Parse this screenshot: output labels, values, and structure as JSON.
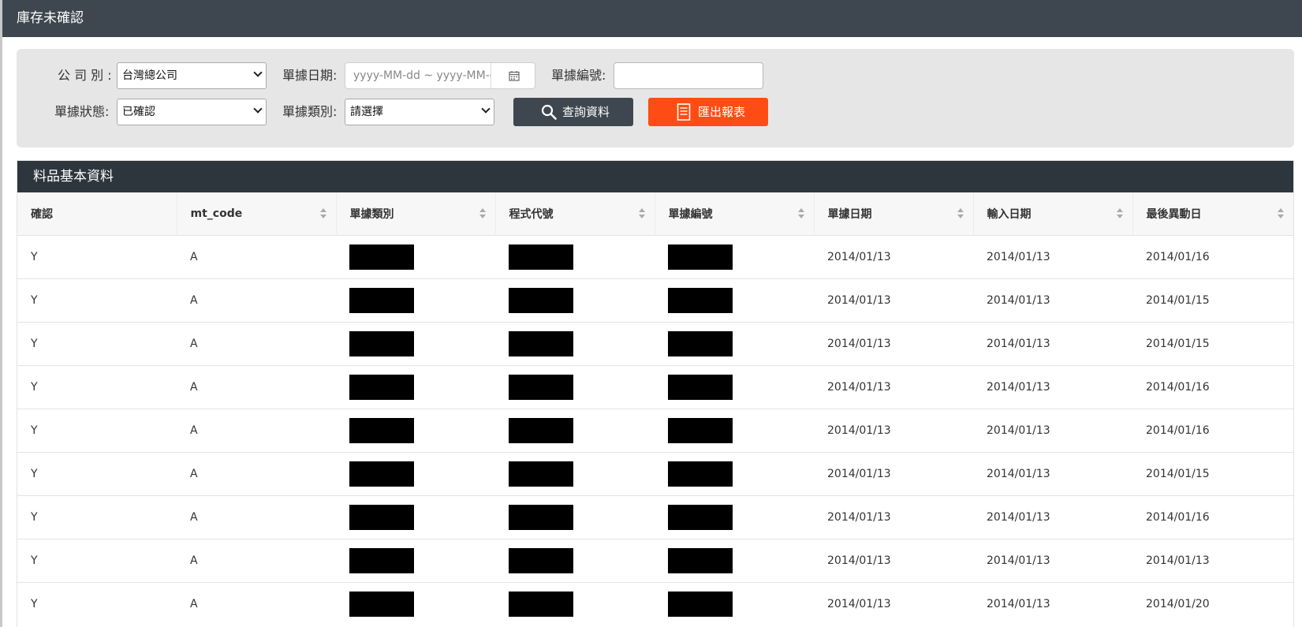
{
  "window_title": "庫存未確認",
  "filters": {
    "company_label": "公 司 別 :",
    "company_value": "台灣總公司",
    "doc_date_label": "單據日期:",
    "doc_date_placeholder": "yyyy-MM-dd ~ yyyy-MM-dd",
    "doc_no_label": "單據編號:",
    "doc_no_value": "",
    "status_label": "單據狀態:",
    "status_value": "已確認",
    "doc_type_label": "單據類別:",
    "doc_type_value": "請選擇",
    "query_button": "查詢資料",
    "export_button": "匯出報表"
  },
  "panel": {
    "title": "料品基本資料"
  },
  "table": {
    "columns": [
      "確認",
      "mt_code",
      "單據類別",
      "程式代號",
      "單據編號",
      "單據日期",
      "輸入日期",
      "最後異動日"
    ],
    "rows": [
      {
        "confirm": "Y",
        "mt_code": "A",
        "doc_date": "2014/01/13",
        "input_date": "2014/01/13",
        "last_modified": "2014/01/16"
      },
      {
        "confirm": "Y",
        "mt_code": "A",
        "doc_date": "2014/01/13",
        "input_date": "2014/01/13",
        "last_modified": "2014/01/15"
      },
      {
        "confirm": "Y",
        "mt_code": "A",
        "doc_date": "2014/01/13",
        "input_date": "2014/01/13",
        "last_modified": "2014/01/15"
      },
      {
        "confirm": "Y",
        "mt_code": "A",
        "doc_date": "2014/01/13",
        "input_date": "2014/01/13",
        "last_modified": "2014/01/16"
      },
      {
        "confirm": "Y",
        "mt_code": "A",
        "doc_date": "2014/01/13",
        "input_date": "2014/01/13",
        "last_modified": "2014/01/16"
      },
      {
        "confirm": "Y",
        "mt_code": "A",
        "doc_date": "2014/01/13",
        "input_date": "2014/01/13",
        "last_modified": "2014/01/15"
      },
      {
        "confirm": "Y",
        "mt_code": "A",
        "doc_date": "2014/01/13",
        "input_date": "2014/01/13",
        "last_modified": "2014/01/16"
      },
      {
        "confirm": "Y",
        "mt_code": "A",
        "doc_date": "2014/01/13",
        "input_date": "2014/01/13",
        "last_modified": "2014/01/13"
      },
      {
        "confirm": "Y",
        "mt_code": "A",
        "doc_date": "2014/01/13",
        "input_date": "2014/01/13",
        "last_modified": "2014/01/20"
      }
    ]
  },
  "icons": {
    "calendar": "calendar-icon",
    "search": "search-icon",
    "export": "document-icon"
  },
  "colors": {
    "topbar": "#3e474f",
    "panel_header": "#2e363d",
    "query_button": "#3e474f",
    "export_button": "#ff4c14"
  }
}
